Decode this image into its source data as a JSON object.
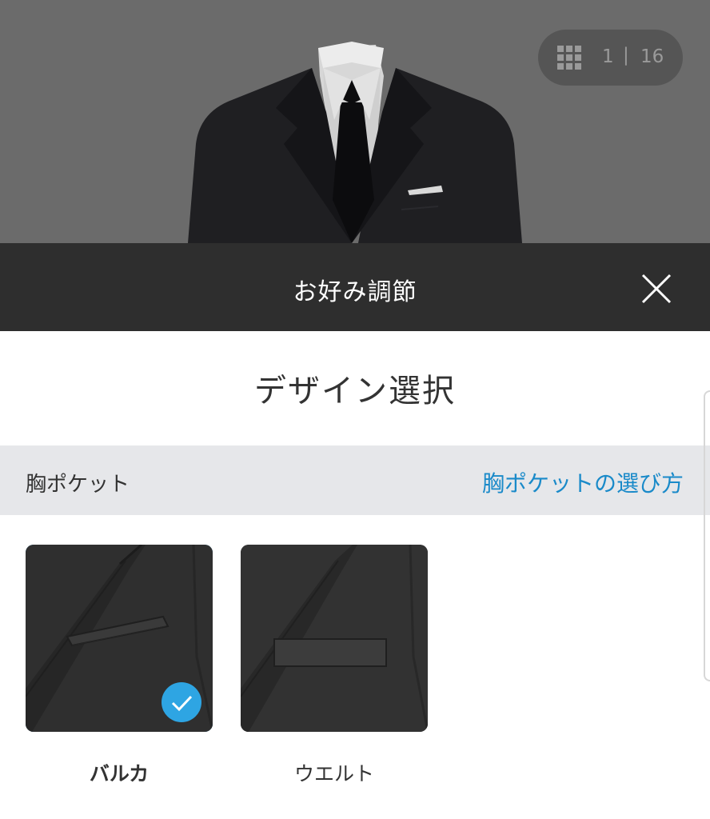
{
  "preview": {
    "counter_current": "1",
    "counter_separator": "|",
    "counter_total": "16",
    "grid_icon": "grid-icon"
  },
  "header": {
    "title": "お好み調節",
    "close_icon": "close-icon"
  },
  "content": {
    "title": "デザイン選択",
    "section": {
      "label": "胸ポケット",
      "link": "胸ポケットの選び方"
    },
    "options": [
      {
        "label": "バルカ",
        "selected": true
      },
      {
        "label": "ウエルト",
        "selected": false
      }
    ]
  },
  "colors": {
    "accent": "#2ea5e3",
    "link": "#1a8ac9",
    "header_bg": "#2e2e2e",
    "preview_bg": "#6b6b6b",
    "section_bg": "#e6e7ea"
  }
}
